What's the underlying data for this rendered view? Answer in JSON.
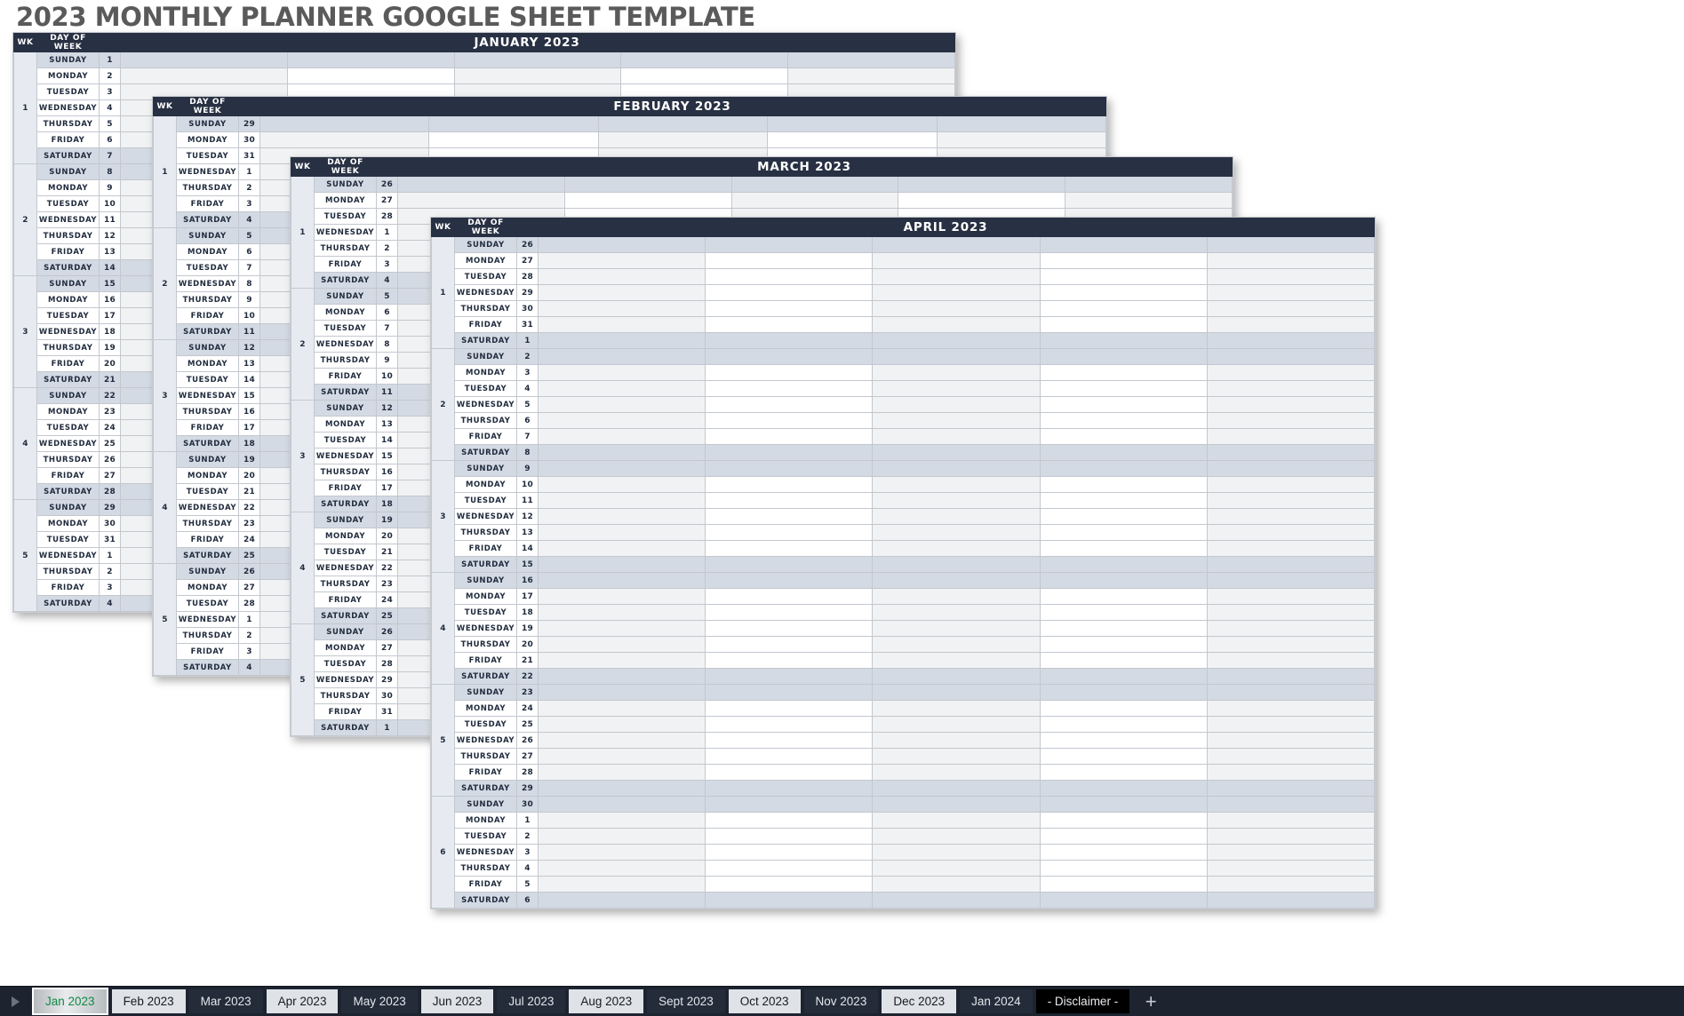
{
  "document": {
    "title": "2023 MONTHLY PLANNER GOOGLE SHEET TEMPLATE"
  },
  "table_headers": {
    "wk": "WK",
    "day_of_week": "DAY OF WEEK"
  },
  "colors": {
    "header_navy": "#283143",
    "weekend_row": "#d3dae4",
    "week_col": "#e7ebf1",
    "cell_gray": "#f1f2f3",
    "cell_white": "#ffffff",
    "title_gray": "#5a5a5a",
    "tabbar_bg": "#1d2430",
    "active_tab_text": "#0f8a46"
  },
  "day_names": [
    "SUNDAY",
    "MONDAY",
    "TUESDAY",
    "WEDNESDAY",
    "THURSDAY",
    "FRIDAY",
    "SATURDAY"
  ],
  "months": [
    {
      "id": "january",
      "title": "JANUARY 2023",
      "weeks": [
        {
          "wk": "1",
          "dates": [
            1,
            2,
            3,
            4,
            5,
            6,
            7
          ]
        },
        {
          "wk": "2",
          "dates": [
            8,
            9,
            10,
            11,
            12,
            13,
            14
          ]
        },
        {
          "wk": "3",
          "dates": [
            15,
            16,
            17,
            18,
            19,
            20,
            21
          ]
        },
        {
          "wk": "4",
          "dates": [
            22,
            23,
            24,
            25,
            26,
            27,
            28
          ]
        },
        {
          "wk": "5",
          "dates": [
            29,
            30,
            31,
            1,
            2,
            3,
            4
          ]
        }
      ]
    },
    {
      "id": "february",
      "title": "FEBRUARY 2023",
      "weeks": [
        {
          "wk": "1",
          "dates": [
            29,
            30,
            31,
            1,
            2,
            3,
            4
          ]
        },
        {
          "wk": "2",
          "dates": [
            5,
            6,
            7,
            8,
            9,
            10,
            11
          ]
        },
        {
          "wk": "3",
          "dates": [
            12,
            13,
            14,
            15,
            16,
            17,
            18
          ]
        },
        {
          "wk": "4",
          "dates": [
            19,
            20,
            21,
            22,
            23,
            24,
            25
          ]
        },
        {
          "wk": "5",
          "dates": [
            26,
            27,
            28,
            1,
            2,
            3,
            4
          ]
        }
      ]
    },
    {
      "id": "march",
      "title": "MARCH 2023",
      "weeks": [
        {
          "wk": "1",
          "dates": [
            26,
            27,
            28,
            1,
            2,
            3,
            4
          ]
        },
        {
          "wk": "2",
          "dates": [
            5,
            6,
            7,
            8,
            9,
            10,
            11
          ]
        },
        {
          "wk": "3",
          "dates": [
            12,
            13,
            14,
            15,
            16,
            17,
            18
          ]
        },
        {
          "wk": "4",
          "dates": [
            19,
            20,
            21,
            22,
            23,
            24,
            25
          ]
        },
        {
          "wk": "5",
          "dates": [
            26,
            27,
            28,
            29,
            30,
            31,
            1
          ]
        }
      ]
    },
    {
      "id": "april",
      "title": "APRIL 2023",
      "weeks": [
        {
          "wk": "1",
          "dates": [
            26,
            27,
            28,
            29,
            30,
            31,
            1
          ]
        },
        {
          "wk": "2",
          "dates": [
            2,
            3,
            4,
            5,
            6,
            7,
            8
          ]
        },
        {
          "wk": "3",
          "dates": [
            9,
            10,
            11,
            12,
            13,
            14,
            15
          ]
        },
        {
          "wk": "4",
          "dates": [
            16,
            17,
            18,
            19,
            20,
            21,
            22
          ]
        },
        {
          "wk": "5",
          "dates": [
            23,
            24,
            25,
            26,
            27,
            28,
            29
          ]
        },
        {
          "wk": "6",
          "dates": [
            30,
            1,
            2,
            3,
            4,
            5,
            6
          ]
        }
      ]
    }
  ],
  "sheet_tabs": [
    {
      "label": "Jan 2023",
      "state": "active"
    },
    {
      "label": "Feb 2023",
      "state": "light"
    },
    {
      "label": "Mar 2023",
      "state": "dark"
    },
    {
      "label": "Apr 2023",
      "state": "light"
    },
    {
      "label": "May 2023",
      "state": "dark"
    },
    {
      "label": "Jun 2023",
      "state": "light"
    },
    {
      "label": "Jul 2023",
      "state": "dark"
    },
    {
      "label": "Aug 2023",
      "state": "light"
    },
    {
      "label": "Sept 2023",
      "state": "dark"
    },
    {
      "label": "Oct 2023",
      "state": "light"
    },
    {
      "label": "Nov 2023",
      "state": "dark"
    },
    {
      "label": "Dec 2023",
      "state": "light"
    },
    {
      "label": "Jan 2024",
      "state": "dark"
    },
    {
      "label": "- Disclaimer -",
      "state": "black"
    }
  ],
  "tabbar_controls": {
    "scroll_left_icon": "triangle-right-icon",
    "add_sheet_label": "+"
  }
}
